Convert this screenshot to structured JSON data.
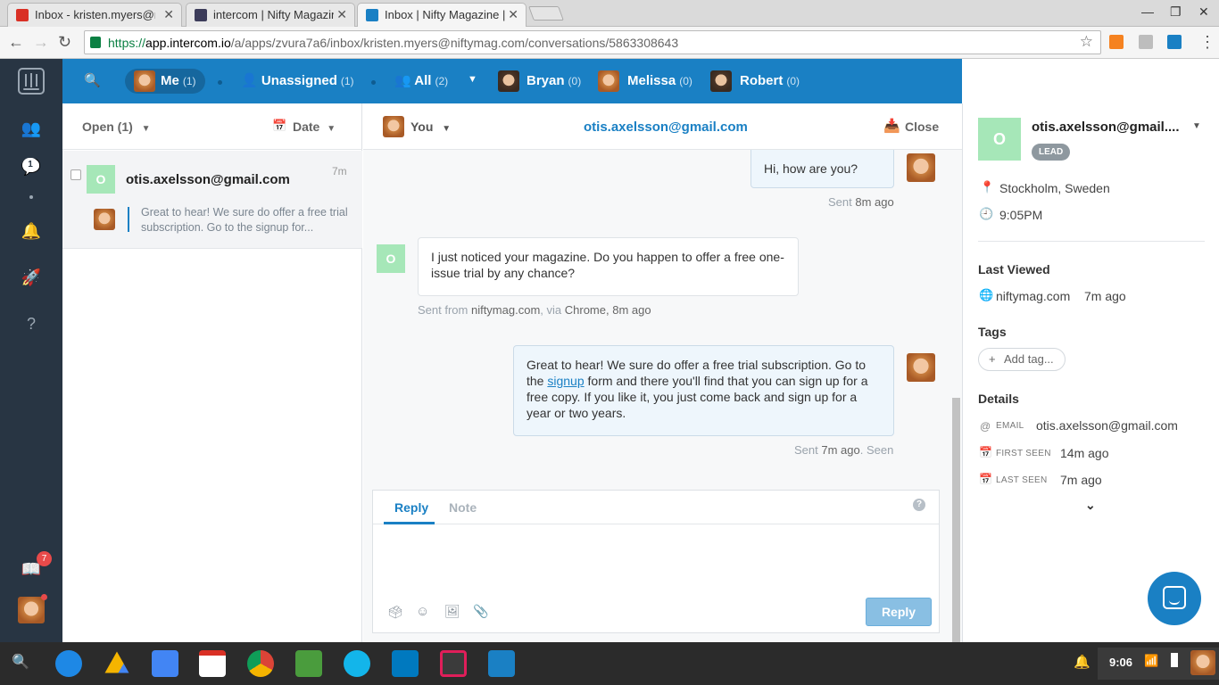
{
  "browser": {
    "tabs": [
      {
        "title": "Inbox - kristen.myers@niftymag.com",
        "active": false,
        "icon_color": "#d93025"
      },
      {
        "title": "intercom | Nifty Magazine",
        "active": false,
        "icon_color": "#3c3c5a"
      },
      {
        "title": "Inbox | Nifty Magazine | Intercom",
        "active": true,
        "icon_color": "#1a80c4"
      }
    ],
    "url": {
      "scheme": "https://",
      "host": "app.intercom.io",
      "path": "/a/apps/zvura7a6/inbox/kristen.myers@niftymag.com/conversations/5863308643"
    }
  },
  "leftnav": {
    "inbox_badge": "1",
    "notifications_badge": "7"
  },
  "topbar": {
    "filters": [
      {
        "label": "Me",
        "count": "(1)"
      },
      {
        "label": "Unassigned",
        "count": "(1)"
      },
      {
        "label": "All",
        "count": "(2)"
      },
      {
        "label": "Bryan",
        "count": "(0)"
      },
      {
        "label": "Melissa",
        "count": "(0)"
      },
      {
        "label": "Robert",
        "count": "(0)"
      }
    ]
  },
  "list": {
    "status_filter": "Open (1)",
    "sort": "Date",
    "item": {
      "avatar_letter": "O",
      "name": "otis.axelsson@gmail.com",
      "time": "7m",
      "preview": "Great to hear! We sure do offer a free trial subscription. Go to the signup for..."
    }
  },
  "conversation": {
    "assignee": "You",
    "title": "otis.axelsson@gmail.com",
    "close_label": "Close",
    "messages": [
      {
        "text": "Hi, how are you?",
        "meta_prefix": "Sent ",
        "meta_time": "8m ago"
      },
      {
        "avatar_letter": "O",
        "text": "I just noticed your magazine. Do you happen to offer a free one-issue trial by any chance?",
        "meta_prefix": "Sent from ",
        "meta_site": "niftymag.com",
        "meta_via": ", via ",
        "meta_browser": "Chrome",
        "meta_time": ", 8m ago"
      },
      {
        "text_before": "Great to hear! We sure do offer a free trial subscription. Go to the ",
        "link": "signup",
        "text_after": " form and there you'll find that you can sign up for a free copy. If you like it, you just come back and sign up for a year or two years.",
        "meta_prefix": "Sent ",
        "meta_time": "7m ago",
        "meta_seen": ". Seen"
      }
    ],
    "composer": {
      "tab_reply": "Reply",
      "tab_note": "Note",
      "help": "?",
      "send_label": "Reply"
    }
  },
  "profile": {
    "avatar_letter": "O",
    "name": "otis.axelsson@gmail....",
    "badge": "LEAD",
    "location": "Stockholm, Sweden",
    "local_time": "9:05PM",
    "last_viewed_label": "Last Viewed",
    "last_viewed_site": "niftymag.com",
    "last_viewed_time": "7m ago",
    "tags_label": "Tags",
    "add_tag": "Add tag...",
    "details_label": "Details",
    "details": [
      {
        "key": "EMAIL",
        "value": "otis.axelsson@gmail.com"
      },
      {
        "key": "FIRST SEEN",
        "value": "14m ago"
      },
      {
        "key": "LAST SEEN",
        "value": "7m ago"
      }
    ]
  },
  "taskbar": {
    "clock": "9:06"
  },
  "colors": {
    "brand_blue": "#1a80c4",
    "nav_dark": "#283543",
    "lead_avatar": "#a6e7b8",
    "link_blue": "#1a80c4"
  }
}
